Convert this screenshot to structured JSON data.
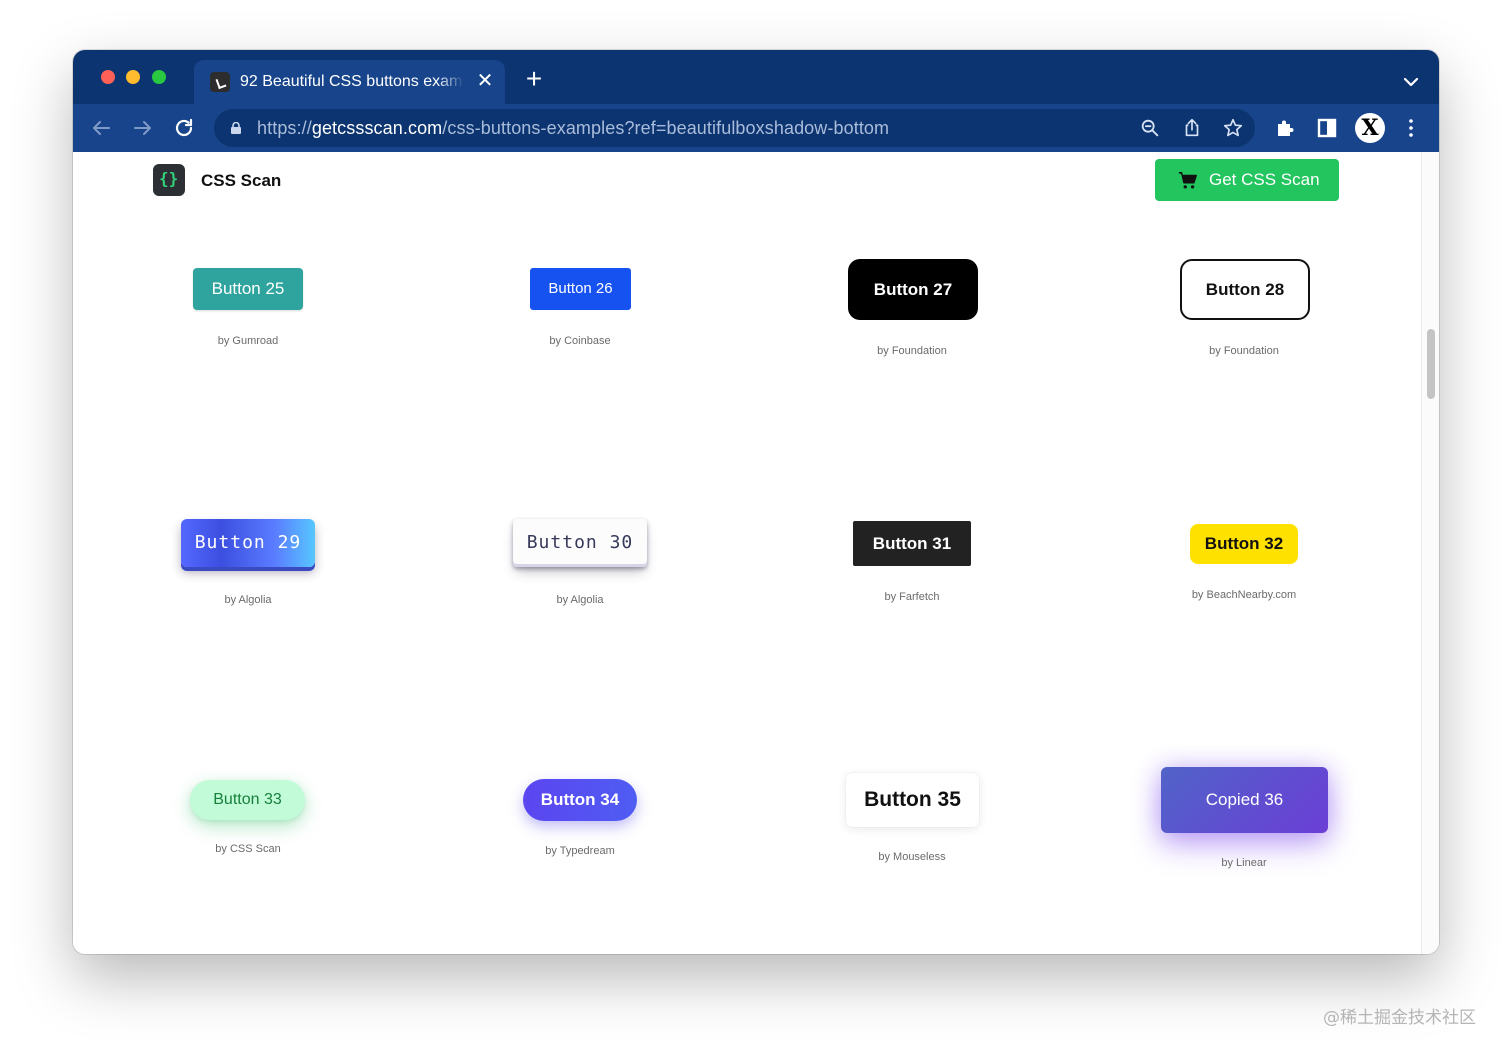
{
  "browser": {
    "tab_title": "92 Beautiful CSS buttons examples",
    "tab_close": "✕",
    "new_tab": "+",
    "url_prefix": "https://",
    "url_host": "getcssscan.com",
    "url_path": "/css-buttons-examples?ref=beautifulboxshadow-bottom",
    "profile_initial": "X",
    "icons": [
      "back-arrow-icon",
      "forward-arrow-icon",
      "reload-icon",
      "lock-icon",
      "zoom-icon",
      "share-icon",
      "star-icon",
      "puzzle-icon",
      "sidepanel-icon",
      "kebab-icon",
      "chevron-down-icon"
    ]
  },
  "site": {
    "name": "CSS Scan",
    "cta_label": "Get CSS Scan",
    "cta_icon": "cart-icon",
    "cta_color": "#22c55e"
  },
  "buttons": [
    {
      "label": "Button 25",
      "by": "by Gumroad",
      "color": "#2fa39e"
    },
    {
      "label": "Button 26",
      "by": "by Coinbase",
      "color": "#1652f0"
    },
    {
      "label": "Button 27",
      "by": "by Foundation",
      "color": "#000000"
    },
    {
      "label": "Button 28",
      "by": "by Foundation",
      "color": "#ffffff"
    },
    {
      "label": "Button 29",
      "by": "by Algolia",
      "color": "#5468ff"
    },
    {
      "label": "Button 30",
      "by": "by Algolia",
      "color": "#fcfcfd"
    },
    {
      "label": "Button 31",
      "by": "by Farfetch",
      "color": "#222222"
    },
    {
      "label": "Button 32",
      "by": "by BeachNearby.com",
      "color": "#ffe100"
    },
    {
      "label": "Button 33",
      "by": "by CSS Scan",
      "color": "#c2fbd7"
    },
    {
      "label": "Button 34",
      "by": "by Typedream",
      "color": "#4f46e5"
    },
    {
      "label": "Button 35",
      "by": "by Mouseless",
      "color": "#ffffff"
    },
    {
      "label": "Copied 36",
      "by": "by Linear",
      "color": "#5e4fd0"
    }
  ],
  "watermark": "@稀土掘金技术社区"
}
